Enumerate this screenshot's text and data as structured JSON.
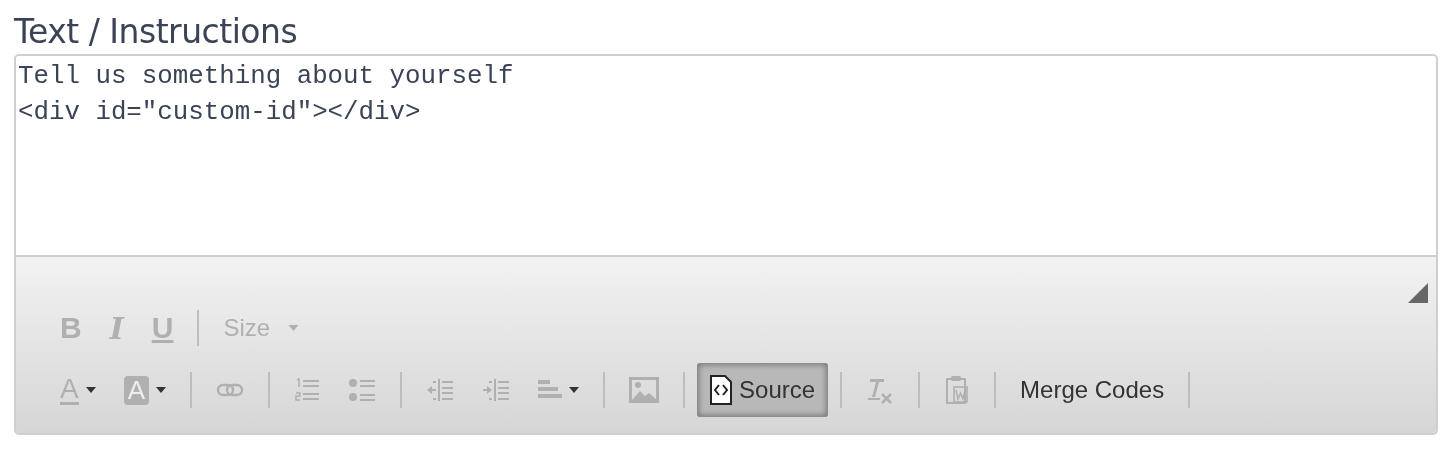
{
  "heading": "Text / Instructions",
  "editor": {
    "lines": [
      "Tell us something about yourself",
      "<div id=\"custom-id\"></div>"
    ],
    "toolbar": [
      [
        {
          "kind": "bold",
          "glyph": "B",
          "disabled": true
        },
        {
          "kind": "italic",
          "glyph": "I",
          "disabled": true
        },
        {
          "kind": "underline",
          "glyph": "U",
          "disabled": true
        },
        {
          "kind": "separator"
        },
        {
          "kind": "combo",
          "label": "Size",
          "disabled": true
        }
      ],
      [
        {
          "kind": "textcolor",
          "glyph": "A",
          "disabled": true
        },
        {
          "kind": "bgcolor",
          "glyph": "A",
          "disabled": true
        },
        {
          "kind": "separator"
        },
        {
          "kind": "link",
          "disabled": true
        },
        {
          "kind": "separator"
        },
        {
          "kind": "numbered",
          "disabled": true
        },
        {
          "kind": "bulleted",
          "disabled": true
        },
        {
          "kind": "separator"
        },
        {
          "kind": "outdent",
          "disabled": true
        },
        {
          "kind": "indent",
          "disabled": true
        },
        {
          "kind": "align",
          "disabled": true
        },
        {
          "kind": "separator"
        },
        {
          "kind": "image",
          "disabled": true
        },
        {
          "kind": "separator"
        },
        {
          "kind": "source",
          "label": "Source",
          "disabled": false,
          "on": true
        },
        {
          "kind": "separator"
        },
        {
          "kind": "clearformat",
          "disabled": true
        },
        {
          "kind": "separator"
        },
        {
          "kind": "pasteword",
          "disabled": true
        },
        {
          "kind": "separator"
        },
        {
          "kind": "plain",
          "label": "Merge Codes",
          "disabled": false,
          "on": false
        },
        {
          "kind": "separator"
        }
      ]
    ]
  }
}
